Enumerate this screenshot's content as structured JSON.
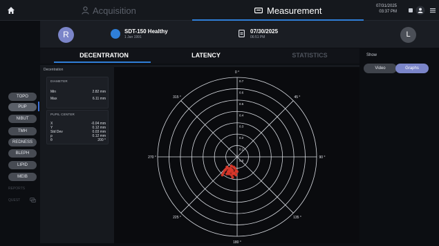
{
  "topbar": {
    "acquisition_label": "Acquisition",
    "measurement_label": "Measurement",
    "date": "07/31/2025",
    "time": "03:37 PM"
  },
  "patient": {
    "avatar_left_letter": "R",
    "name": "SDT-150 Healthy",
    "dob": "1 Jan 1991",
    "exam_date": "07/30/2025",
    "exam_time": "06:51 PM",
    "avatar_right_letter": "L"
  },
  "nav": {
    "items": [
      "TOPO",
      "PUP",
      "NIBUT",
      "TMH",
      "REDNESS",
      "BLEPH",
      "LIPID",
      "MEIB"
    ],
    "active": "PUP",
    "dim_items": [
      "REPORTS",
      "QUEST"
    ]
  },
  "tabs": {
    "decentration": "DECENTRATION",
    "latency": "LATENCY",
    "statistics": "STATISTICS"
  },
  "content": {
    "section_label": "Decentration",
    "diameter": {
      "title": "DIAMETER",
      "rows": [
        {
          "label": "Min",
          "value": "2.82 mm"
        },
        {
          "label": "Max",
          "value": "6.11 mm"
        }
      ]
    },
    "pupil_center": {
      "title": "PUPIL CENTER",
      "rows": [
        {
          "label": "X",
          "value": "-0.04 mm"
        },
        {
          "label": "Y",
          "value": "0.12 mm"
        },
        {
          "label": "Std Dev",
          "value": "0.03 mm"
        },
        {
          "label": "ρ",
          "value": "0.12 mm"
        },
        {
          "label": "θ",
          "value": "200 °"
        }
      ]
    }
  },
  "right": {
    "show_label": "Show",
    "video_label": "Video",
    "graphs_label": "Graphs"
  },
  "colors": {
    "accent": "#2f7fd8",
    "pill_active": "#7b85c9",
    "points": "#e0392b"
  },
  "chart_data": {
    "type": "scatter",
    "polar": true,
    "radial_ticks": [
      "0.0",
      "0.1",
      "0.2",
      "0.3",
      "0.4",
      "0.5",
      "0.6",
      "0.7"
    ],
    "rlim": [
      0,
      0.7
    ],
    "angle_labels": [
      "0 °",
      "45 °",
      "90 °",
      "135 °",
      "180 °",
      "225 °",
      "270 °",
      "315 °"
    ],
    "grid": true,
    "points_xy_mm": [
      [
        -0.04,
        -0.12
      ],
      [
        -0.06,
        -0.1
      ],
      [
        -0.02,
        -0.14
      ],
      [
        -0.08,
        -0.13
      ],
      [
        -0.05,
        -0.16
      ],
      [
        -0.03,
        -0.09
      ],
      [
        -0.1,
        -0.11
      ],
      [
        -0.01,
        -0.12
      ],
      [
        -0.07,
        -0.15
      ],
      [
        -0.04,
        -0.18
      ],
      [
        -0.12,
        -0.14
      ],
      [
        -0.09,
        -0.09
      ],
      [
        -0.02,
        -0.1
      ],
      [
        -0.06,
        -0.13
      ],
      [
        -0.05,
        -0.11
      ],
      [
        0.0,
        -0.13
      ],
      [
        -0.11,
        -0.12
      ],
      [
        -0.03,
        -0.15
      ],
      [
        -0.08,
        -0.1
      ],
      [
        -0.04,
        -0.14
      ],
      [
        -0.13,
        -0.16
      ],
      [
        -0.07,
        -0.12
      ],
      [
        -0.01,
        -0.16
      ],
      [
        -0.05,
        -0.08
      ],
      [
        -0.09,
        -0.15
      ]
    ]
  }
}
